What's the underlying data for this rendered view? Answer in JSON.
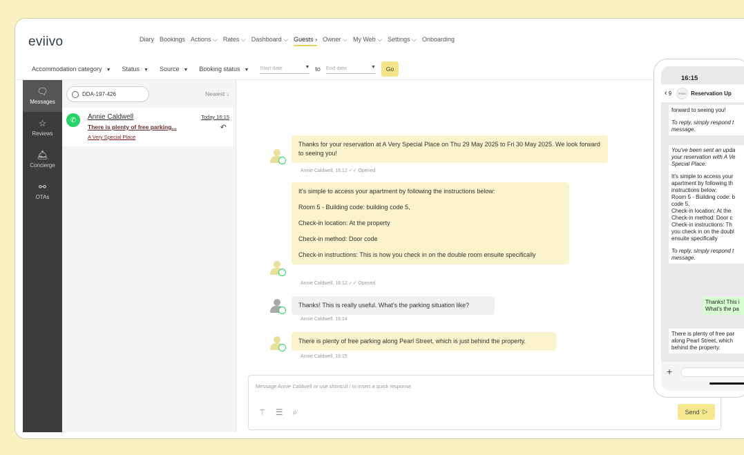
{
  "app": {
    "logo": "eviivo"
  },
  "topnav": [
    "Diary",
    "Bookings",
    "Actions ⌵",
    "Rates ⌵",
    "Dashboard ⌵",
    "Guests ›",
    "Owner ⌵",
    "My Web ⌵",
    "Settings ⌵",
    "Onboarding"
  ],
  "filters": {
    "accommodation": "Accommodation category",
    "status": "Status",
    "source": "Source",
    "booking_status": "Booking status",
    "start_placeholder": "Start date",
    "to": "to",
    "end_placeholder": "End date",
    "go": "Go"
  },
  "sidebar": {
    "messages": "Messages",
    "reviews": "Reviews",
    "concierge": "Concierge",
    "otas": "OTAs"
  },
  "list": {
    "search_value": "DDA-197-426",
    "sort": "Newest ↓",
    "conversation": {
      "name": "Annie Caldwell",
      "preview": "There is plenty of free parking...",
      "property": "A Very Special Place",
      "time": "Today 16:15"
    }
  },
  "chat": {
    "msg1": {
      "text": "Thanks for your reservation at A Very Special Place on Thu 29 May 2025 to Fri 30 May 2025. We look forward to seeing you!",
      "meta": "Annie Caldwell, 16:12 ✓✓ Opened"
    },
    "msg2": {
      "p1": "It's simple to access your apartment by following the instructions below:",
      "p2": "Room 5 - Building code: building code 5,",
      "p3": "Check-in location: At the property",
      "p4": "Check-in method: Door code",
      "p5": "Check-in instructions: This is how you check in on the double room ensuite specifically",
      "meta": "Annie Caldwell, 16:12 ✓✓ Opened"
    },
    "msg3": {
      "text": "Thanks! This is really useful. What's the parking situation like?",
      "meta": "Annie Caldwell, 16:14"
    },
    "msg4": {
      "text": "There is plenty of free parking along Pearl Street, which is just behind the property.",
      "meta": "Annie Caldwell, 16:15"
    }
  },
  "composer": {
    "placeholder": "Message Annie Caldwell or use shortcut / to insert a quick response",
    "send": "Send"
  },
  "phone": {
    "time": "16:15",
    "back_count": "9",
    "logo": "eviivo",
    "title": "Reservation Up",
    "m1_top": "forward to seeing you!",
    "m1_reply": "To reply, simply respond t",
    "m1_reply2": "message.",
    "m2_l1": "You've been sent an upda",
    "m2_l2": "your reservation with A Ve",
    "m2_l3": "Special Place:",
    "m2_l4": "It's simple to access your",
    "m2_l5": "apartment by following th",
    "m2_l6": "instructions below:",
    "m2_l7": "Room 5 - Building code: b",
    "m2_l8": "code 5,",
    "m2_l9": "Check-in location: At the",
    "m2_l10": "Check-in method: Door c",
    "m2_l11": "Check-in instructions: Th",
    "m2_l12": "you check in on the doubl",
    "m2_l13": "ensuite specifically",
    "m2_reply": "To reply, simply respond t",
    "m2_reply2": "message.",
    "m3_l1": "Thanks! This i",
    "m3_l2": "What's the pa",
    "m4_l1": "There is plenty of free par",
    "m4_l2": "along Pearl Street, which",
    "m4_l3": "behind the property."
  },
  "colors": {
    "page_bg": "#fbf0c1",
    "accent_yellow": "#f4e487",
    "bubble_out": "#fbf3cc",
    "whatsapp_green": "#25d366",
    "sidebar_dark": "#3c3c3c"
  }
}
